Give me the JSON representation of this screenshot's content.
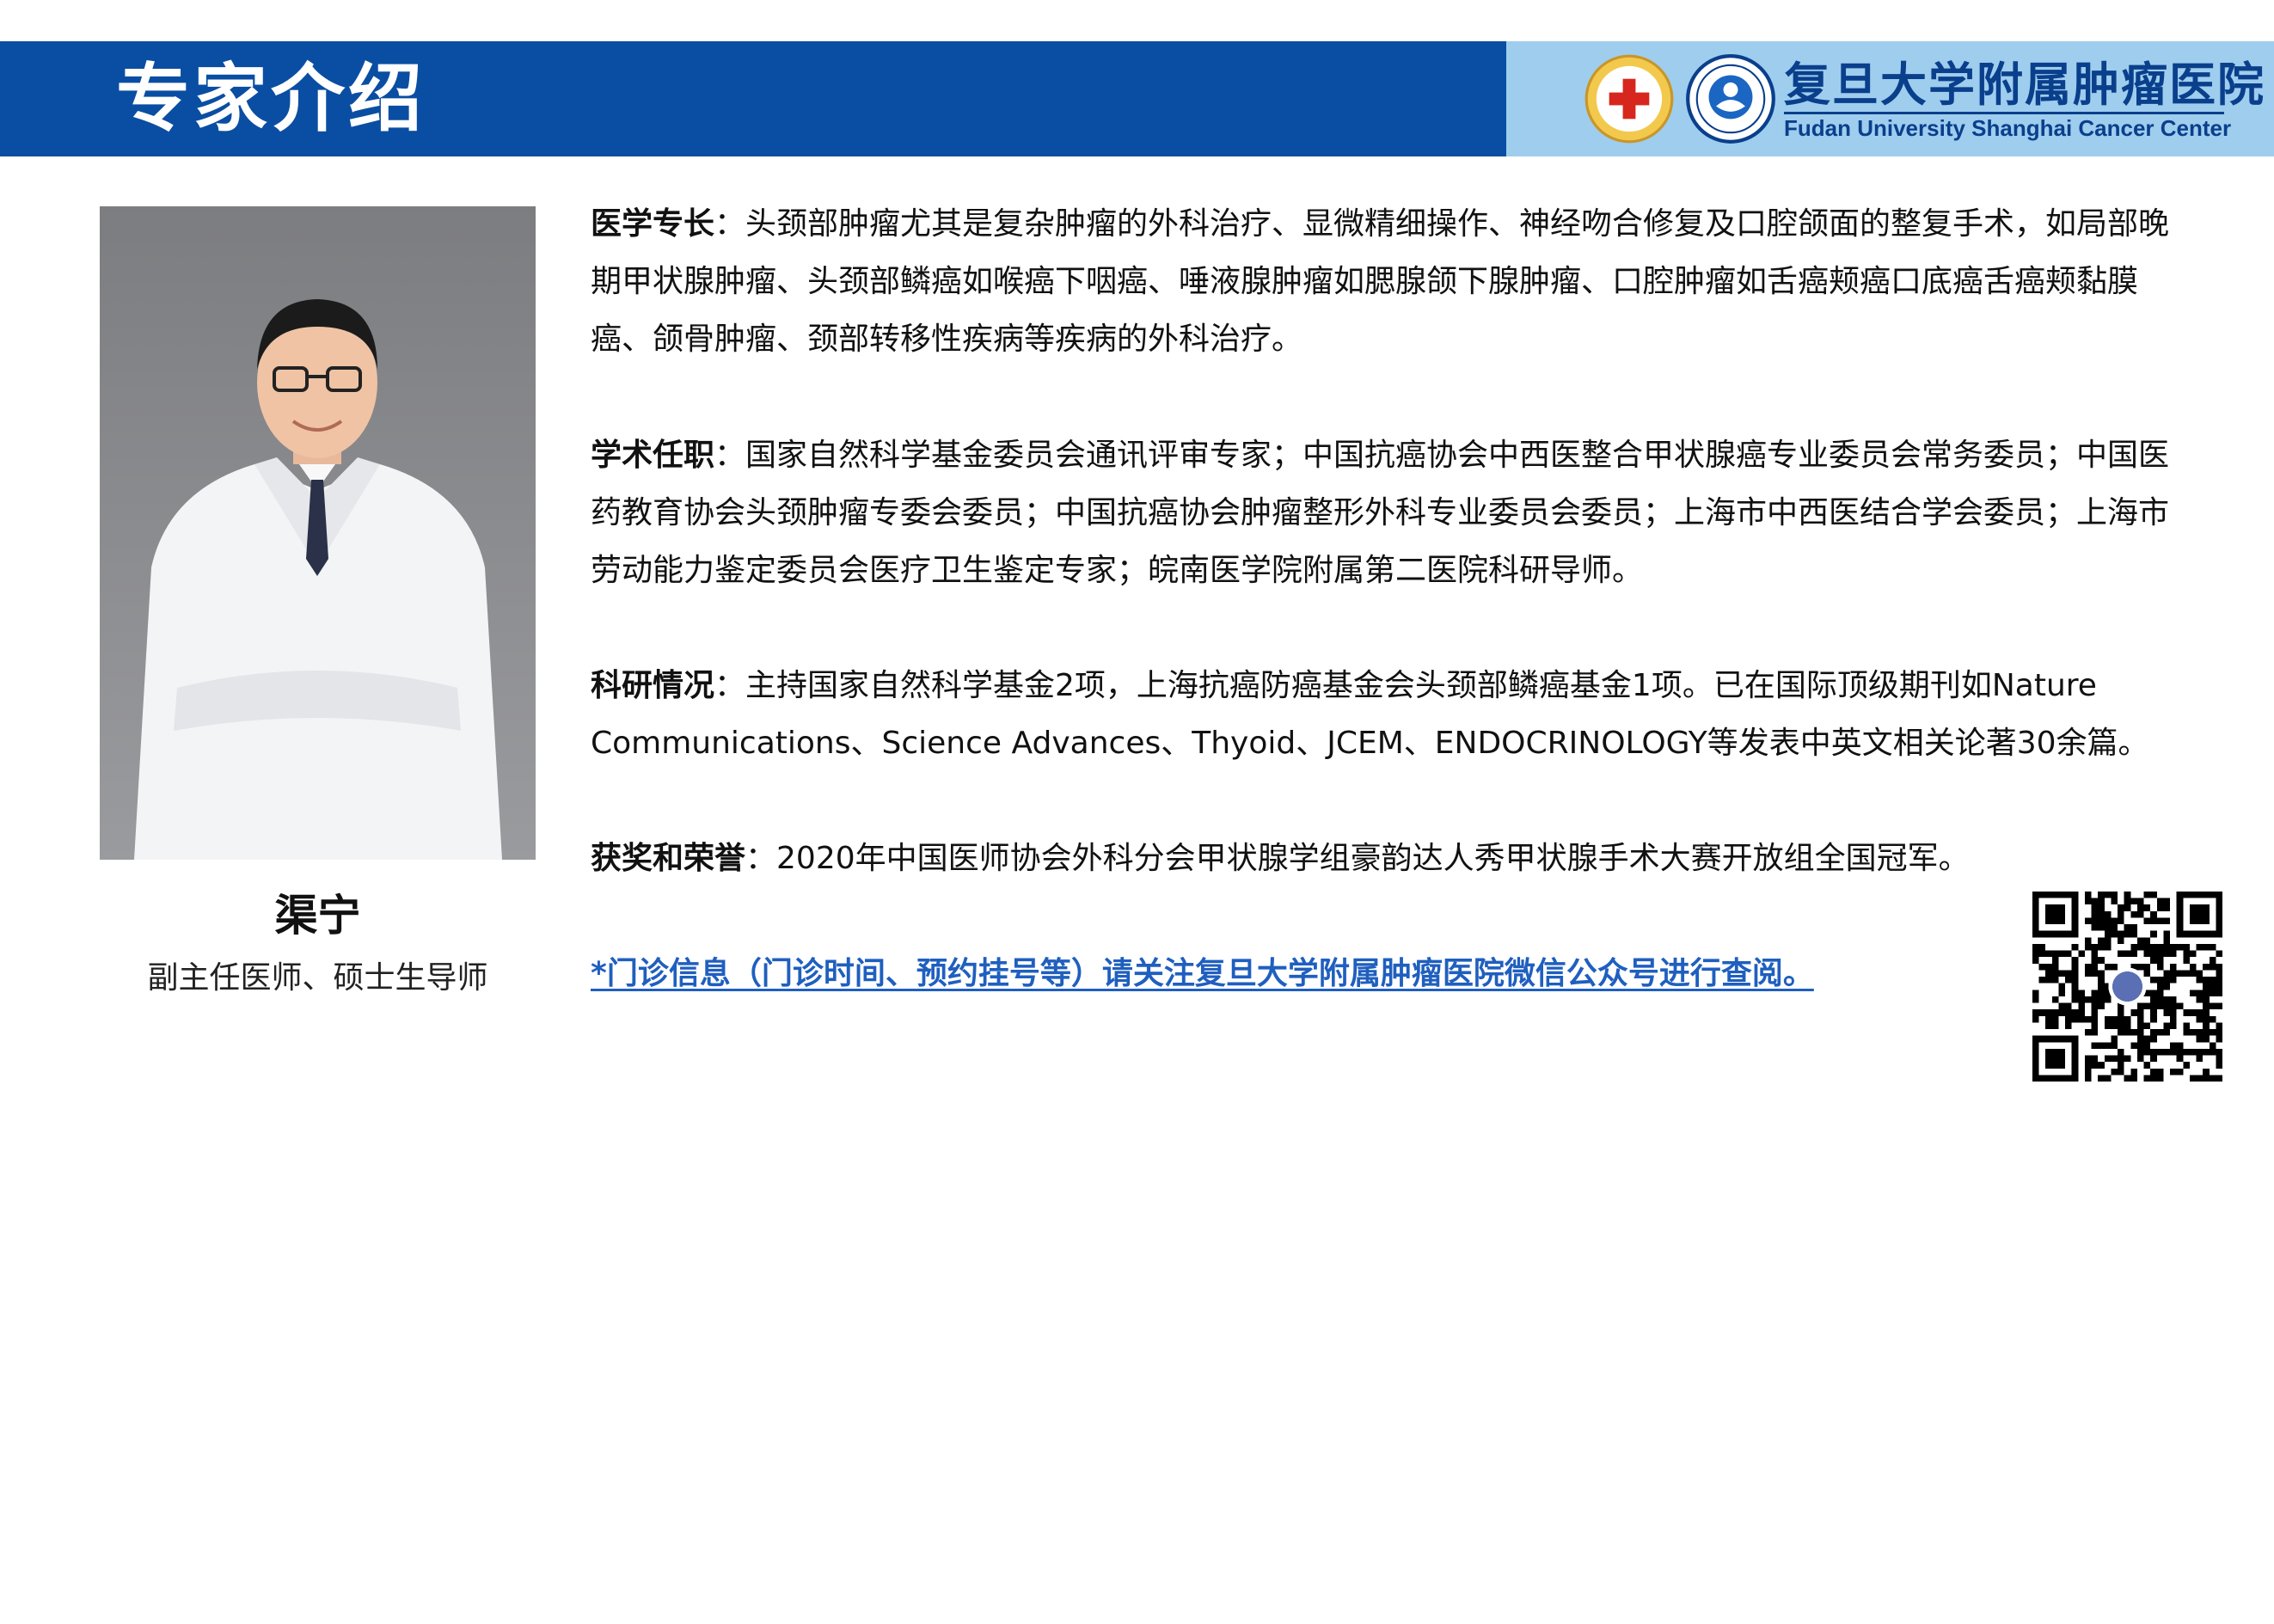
{
  "header": {
    "title": "专家介绍",
    "logo_cn": "复旦大学附属肿瘤医院",
    "logo_en": "Fudan University Shanghai Cancer Center"
  },
  "profile": {
    "name": "渠宁",
    "title": "副主任医师、硕士生导师"
  },
  "sections": [
    {
      "label": "医学专长",
      "separator": "：",
      "text": "头颈部肿瘤尤其是复杂肿瘤的外科治疗、显微精细操作、神经吻合修复及口腔颌面的整复手术，如局部晚期甲状腺肿瘤、头颈部鳞癌如喉癌下咽癌、唾液腺肿瘤如腮腺颌下腺肿瘤、口腔肿瘤如舌癌颊癌口底癌舌癌颊黏膜癌、颌骨肿瘤、颈部转移性疾病等疾病的外科治疗。"
    },
    {
      "label": "学术任职",
      "separator": "：",
      "text": "国家自然科学基金委员会通讯评审专家；中国抗癌协会中西医整合甲状腺癌专业委员会常务委员；中国医药教育协会头颈肿瘤专委会委员；中国抗癌协会肿瘤整形外科专业委员会委员；上海市中西医结合学会委员；上海市劳动能力鉴定委员会医疗卫生鉴定专家；皖南医学院附属第二医院科研导师。"
    },
    {
      "label": "科研情况",
      "separator": "：",
      "text": "主持国家自然科学基金2项，上海抗癌防癌基金会头颈部鳞癌基金1项。已在国际顶级期刊如Nature Communications、Science Advances、Thyoid、JCEM、ENDOCRINOLOGY等发表中英文相关论著30余篇。"
    },
    {
      "label": "获奖和荣誉",
      "separator": "：",
      "text": "2020年中国医师协会外科分会甲状腺学组豪韵达人秀甲状腺手术大赛开放组全国冠军。"
    }
  ],
  "clinic_notice": "*门诊信息（门诊时间、预约挂号等）请关注复旦大学附属肿瘤医院微信公众号进行查阅。",
  "colors": {
    "header_blue": "#0a4ea3",
    "logo_bg": "#9fcdee",
    "link_blue": "#1f5fbf"
  }
}
